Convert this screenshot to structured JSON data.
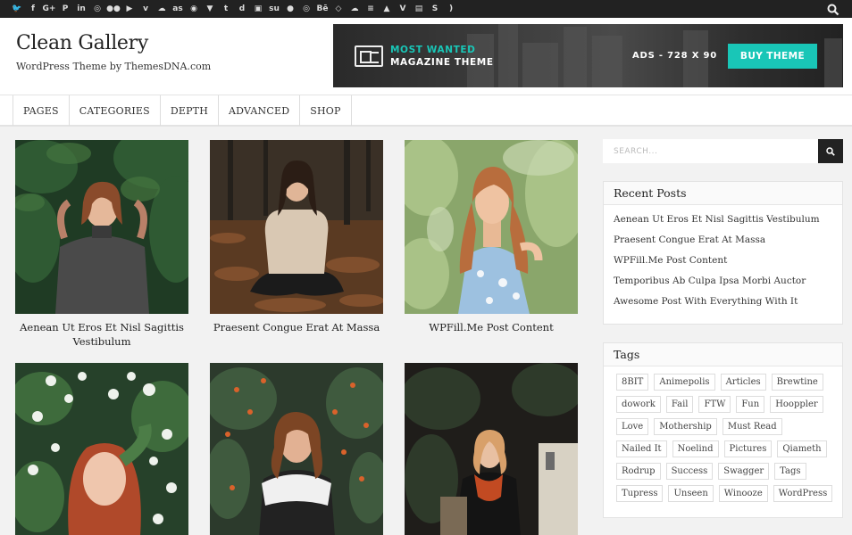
{
  "social_icons": [
    "twitter-icon",
    "facebook-icon",
    "google-plus-icon",
    "pinterest-icon",
    "linkedin-icon",
    "instagram-icon",
    "flickr-icon",
    "youtube-icon",
    "vimeo-icon",
    "soundcloud-icon",
    "lastfm-icon",
    "github-icon",
    "bitbucket-icon",
    "tumblr-icon",
    "digg-icon",
    "delicious-icon",
    "stumbleupon-icon",
    "reddit-icon",
    "dribbble-icon",
    "behance-icon",
    "codepen-icon",
    "jsfiddle-icon",
    "stackoverflow-icon",
    "foursquare-icon",
    "vine-icon",
    "slideshare-icon",
    "skype-icon",
    "rss-icon"
  ],
  "site": {
    "title": "Clean Gallery",
    "tagline": "WordPress Theme by ThemesDNA.com"
  },
  "ad": {
    "line1": "MOST WANTED",
    "line2": "MAGAZINE THEME",
    "size": "ADS - 728 X 90",
    "button": "BUY THEME",
    "accent_color": "#19c6b7"
  },
  "nav": {
    "items": [
      "PAGES",
      "CATEGORIES",
      "DEPTH",
      "ADVANCED",
      "SHOP"
    ]
  },
  "posts": [
    {
      "title": "Aenean Ut Eros Et Nisl Sagittis Vestibulum"
    },
    {
      "title": "Praesent Congue Erat At Massa"
    },
    {
      "title": "WPFill.Me Post Content"
    },
    {
      "title": ""
    },
    {
      "title": ""
    },
    {
      "title": ""
    }
  ],
  "sidebar": {
    "search_placeholder": "SEARCH...",
    "recent_title": "Recent Posts",
    "recent_posts": [
      "Aenean Ut Eros Et Nisl Sagittis Vestibulum",
      "Praesent Congue Erat At Massa",
      "WPFill.Me Post Content",
      "Temporibus Ab Culpa Ipsa Morbi Auctor",
      "Awesome Post With Everything With It"
    ],
    "tags_title": "Tags",
    "tags": [
      "8BIT",
      "Animepolis",
      "Articles",
      "Brewtine",
      "dowork",
      "Fail",
      "FTW",
      "Fun",
      "Hooppler",
      "Love",
      "Mothership",
      "Must Read",
      "Nailed It",
      "Noelind",
      "Pictures",
      "Qiameth",
      "Rodrup",
      "Success",
      "Swagger",
      "Tags",
      "Tupress",
      "Unseen",
      "Winooze",
      "WordPress"
    ]
  }
}
